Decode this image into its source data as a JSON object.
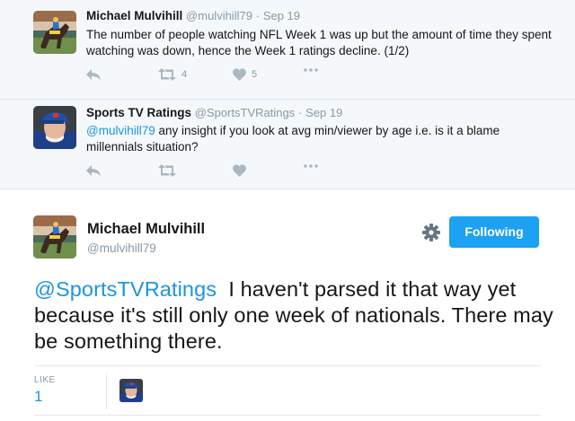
{
  "tweet1": {
    "fullname": "Michael Mulvihill",
    "handle": "@mulvihill79",
    "time": "Sep 19",
    "text": "The number of people watching NFL Week 1 was up but the amount of time they spent watching was down, hence the Week 1 ratings decline. (1/2)",
    "retweets": "4",
    "likes": "5",
    "avatar_icon": "horse-racing-avatar"
  },
  "tweet2": {
    "fullname": "Sports TV Ratings",
    "handle": "@SportsTVRatings",
    "time": "Sep 19",
    "mention": "@mulvihill79",
    "text": "any insight if you look at avg min/viewer by age i.e. is it a blame millennials situation?",
    "avatar_icon": "man-in-blue-cap-avatar"
  },
  "main": {
    "fullname": "Michael Mulvihill",
    "handle": "@mulvihill79",
    "follow_label": "Following",
    "mention": "@SportsTVRatings",
    "text": "I haven't parsed it that way yet because it's still only one week of nationals. There may be something there.",
    "like_label": "LIKE",
    "like_count": "1"
  },
  "colors": {
    "link": "#1b95e0",
    "follow_button": "#1da1f2",
    "muted": "#8899a6",
    "context_bg": "#f5f8fa"
  },
  "separator": "·"
}
